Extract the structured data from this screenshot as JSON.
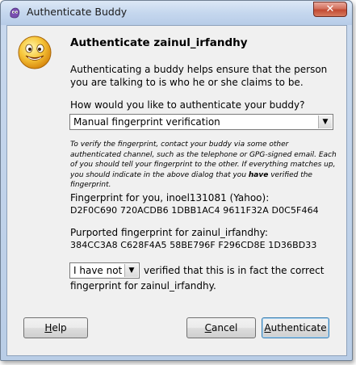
{
  "window": {
    "title": "Authenticate Buddy",
    "close_glyph": "✕"
  },
  "dialog": {
    "heading": "Authenticate zainul_irfandhy",
    "intro": "Authenticating a buddy helps ensure that the person you are talking to is who he or she claims to be.",
    "question": "How would you like to authenticate your buddy?",
    "method_value": "Manual fingerprint verification",
    "note_before": "To verify the fingerprint, contact your buddy via some other authenticated channel, such as the telephone or GPG-signed email.  Each of you should tell your fingerprint to the other. If everything matches up, you should indicate in the above dialog that you ",
    "note_bold": "have",
    "note_after": " verified the fingerprint.",
    "your_fp_label": "Fingerprint for you, inoel131081 (Yahoo):",
    "your_fp": "D2F0C690 720ACDB6 1DBB1AC4 9611F32A D0C5F464",
    "buddy_fp_label": "Purported fingerprint for zainul_irfandhy:",
    "buddy_fp": "384CC3A8 C628F4A5 58BE796F F296CD8E 1D36BD33",
    "verified_value": "I have not",
    "verified_text_1": "verified that this is in fact the correct",
    "verified_text_2": "fingerprint for zainul_irfandhy.",
    "dropdown_glyph": "▼"
  },
  "buttons": {
    "help_mnemonic": "H",
    "help_rest": "elp",
    "cancel_mnemonic": "C",
    "cancel_rest": "ancel",
    "auth_mnemonic": "A",
    "auth_rest": "uthenticate"
  },
  "icons": {
    "title_icon": "pidgin-purple-icon",
    "dialog_icon": "smiley-face-icon"
  },
  "colors": {
    "title_bar": "#c5d7ee",
    "close_button": "#c24a32",
    "client_background": "#f0f0f0"
  }
}
